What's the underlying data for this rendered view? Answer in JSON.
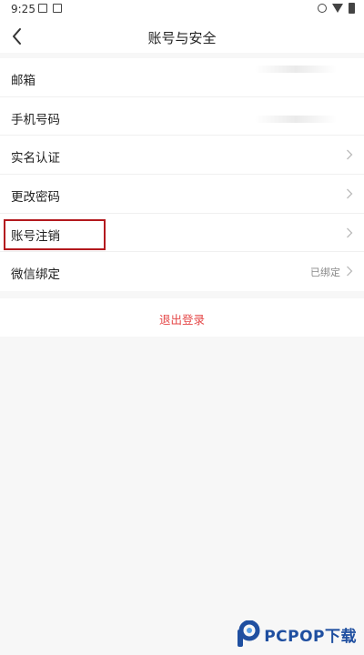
{
  "status_bar": {
    "time": "9:25"
  },
  "nav": {
    "title": "账号与安全"
  },
  "settings": {
    "items": [
      {
        "label": "邮箱"
      },
      {
        "label": "手机号码"
      },
      {
        "label": "实名认证"
      },
      {
        "label": "更改密码"
      },
      {
        "label": "账号注销"
      },
      {
        "label": "微信绑定",
        "value": "已绑定"
      }
    ]
  },
  "logout": {
    "label": "退出登录"
  },
  "watermark": {
    "text": "PCPOP下载"
  },
  "colors": {
    "accent_red": "#e54848",
    "highlight_border": "#b3191e",
    "watermark_blue": "#1f4fa0"
  }
}
